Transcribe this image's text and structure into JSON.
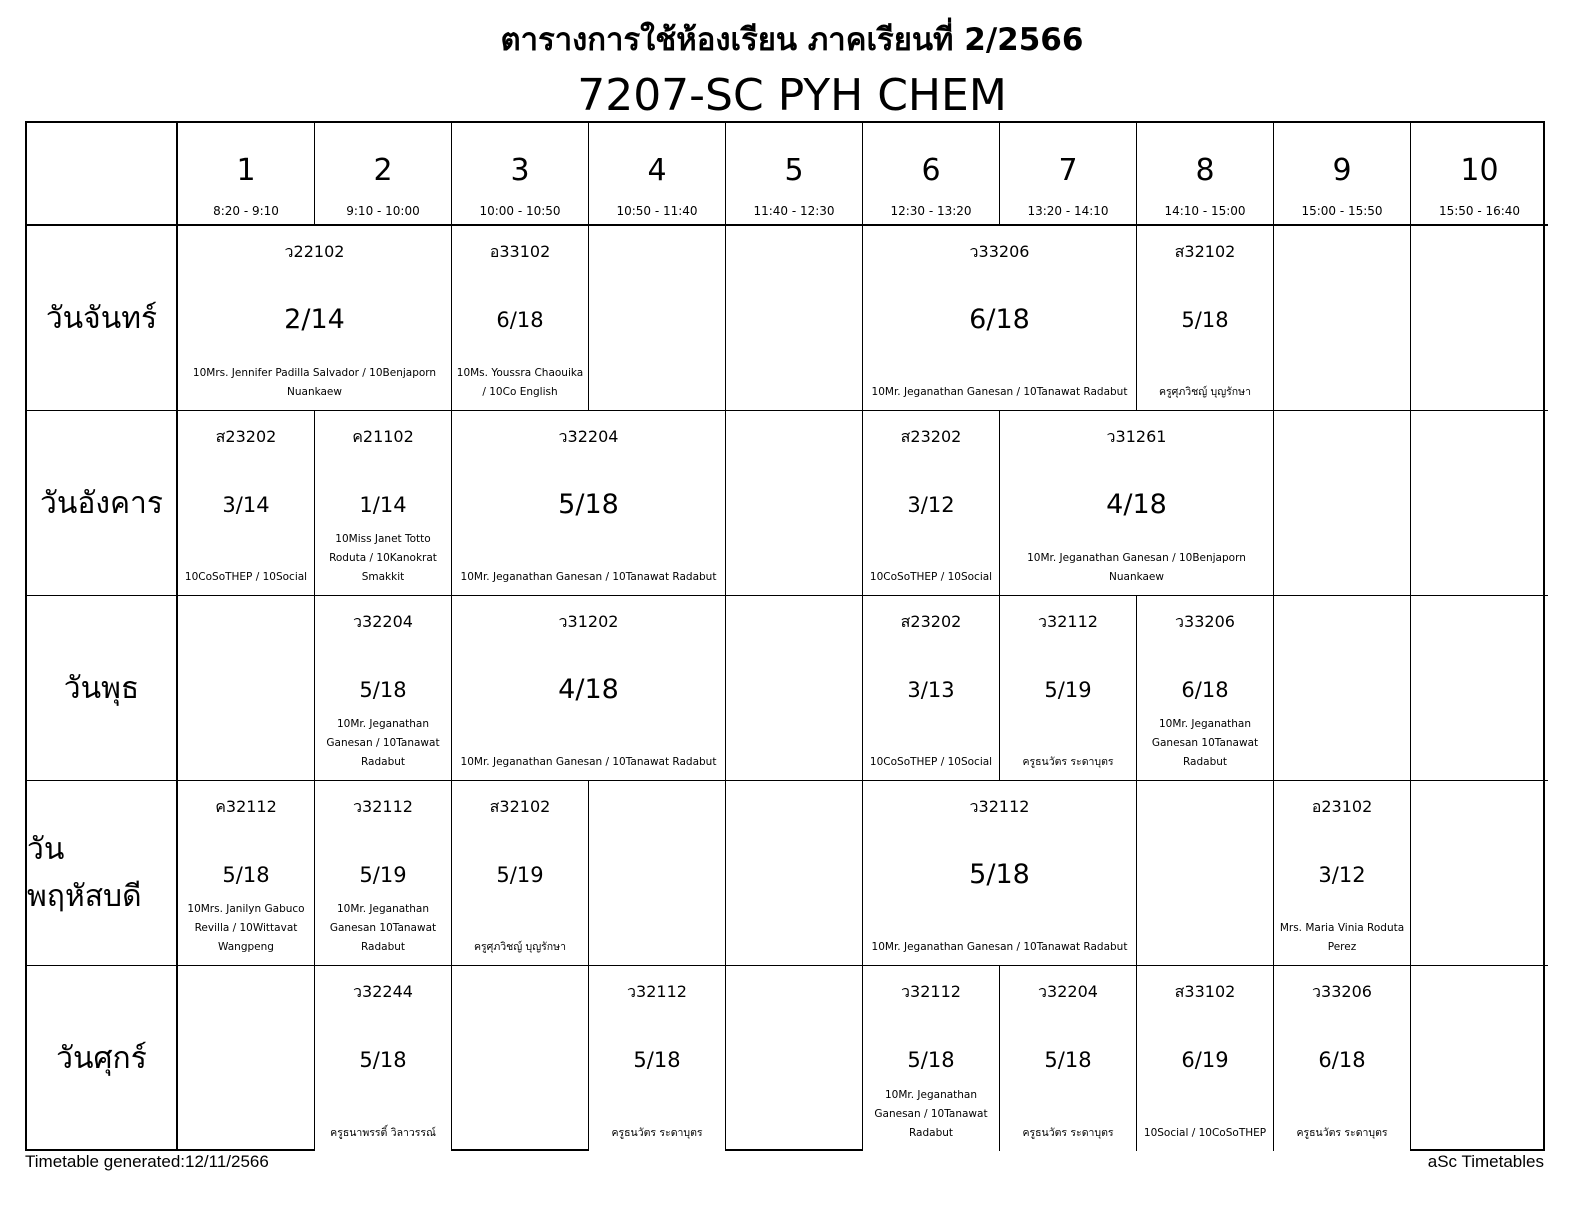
{
  "header": {
    "title": "ตารางการใช้ห้องเรียน ภาคเรียนที่ 2/2566",
    "room": "7207-SC PYH CHEM"
  },
  "periods": [
    {
      "num": "1",
      "time": "8:20 - 9:10"
    },
    {
      "num": "2",
      "time": "9:10 - 10:00"
    },
    {
      "num": "3",
      "time": "10:00 - 10:50"
    },
    {
      "num": "4",
      "time": "10:50 - 11:40"
    },
    {
      "num": "5",
      "time": "11:40 - 12:30"
    },
    {
      "num": "6",
      "time": "12:30 - 13:20"
    },
    {
      "num": "7",
      "time": "13:20 - 14:10"
    },
    {
      "num": "8",
      "time": "14:10 - 15:00"
    },
    {
      "num": "9",
      "time": "15:00 - 15:50"
    },
    {
      "num": "10",
      "time": "15:50 - 16:40"
    }
  ],
  "days": [
    {
      "name": "วันจันทร์",
      "lessons": [
        {
          "start": 1,
          "span": 2,
          "subject": "ว22102",
          "class": "2/14",
          "teacher": "10Mrs. Jennifer Padilla Salvador / 10Benjaporn Nuankaew"
        },
        {
          "start": 3,
          "span": 1,
          "subject": "อ33102",
          "class": "6/18",
          "teacher": "10Ms. Youssra Chaouika / 10Co English"
        },
        {
          "start": 6,
          "span": 2,
          "subject": "ว33206",
          "class": "6/18",
          "teacher": "10Mr. Jeganathan Ganesan / 10Tanawat Radabut"
        },
        {
          "start": 8,
          "span": 1,
          "subject": "ส32102",
          "class": "5/18",
          "teacher": "ครูศุภวิชญ์ บุญรักษา"
        }
      ]
    },
    {
      "name": "วันอังคาร",
      "lessons": [
        {
          "start": 1,
          "span": 1,
          "subject": "ส23202",
          "class": "3/14",
          "teacher": "10CoSoTHEP / 10Social"
        },
        {
          "start": 2,
          "span": 1,
          "subject": "ค21102",
          "class": "1/14",
          "teacher": "10Miss Janet Totto Roduta / 10Kanokrat Smakkit"
        },
        {
          "start": 3,
          "span": 2,
          "subject": "ว32204",
          "class": "5/18",
          "teacher": "10Mr. Jeganathan Ganesan / 10Tanawat Radabut"
        },
        {
          "start": 6,
          "span": 1,
          "subject": "ส23202",
          "class": "3/12",
          "teacher": "10CoSoTHEP / 10Social"
        },
        {
          "start": 7,
          "span": 2,
          "subject": "ว31261",
          "class": "4/18",
          "teacher": "10Mr. Jeganathan Ganesan / 10Benjaporn Nuankaew"
        }
      ]
    },
    {
      "name": "วันพุธ",
      "lessons": [
        {
          "start": 2,
          "span": 1,
          "subject": "ว32204",
          "class": "5/18",
          "teacher": "10Mr. Jeganathan Ganesan / 10Tanawat Radabut"
        },
        {
          "start": 3,
          "span": 2,
          "subject": "ว31202",
          "class": "4/18",
          "teacher": "10Mr. Jeganathan Ganesan / 10Tanawat Radabut"
        },
        {
          "start": 6,
          "span": 1,
          "subject": "ส23202",
          "class": "3/13",
          "teacher": "10CoSoTHEP / 10Social"
        },
        {
          "start": 7,
          "span": 1,
          "subject": "ว32112",
          "class": "5/19",
          "teacher": "ครูธนวัตร ระดาบุตร"
        },
        {
          "start": 8,
          "span": 1,
          "subject": "ว33206",
          "class": "6/18",
          "teacher": "10Mr. Jeganathan Ganesan 10Tanawat Radabut"
        }
      ]
    },
    {
      "name": "วันพฤหัสบดี",
      "lessons": [
        {
          "start": 1,
          "span": 1,
          "subject": "ค32112",
          "class": "5/18",
          "teacher": "10Mrs. Janilyn Gabuco Revilla / 10Wittavat Wangpeng"
        },
        {
          "start": 2,
          "span": 1,
          "subject": "ว32112",
          "class": "5/19",
          "teacher": "10Mr. Jeganathan Ganesan 10Tanawat Radabut"
        },
        {
          "start": 3,
          "span": 1,
          "subject": "ส32102",
          "class": "5/19",
          "teacher": "ครูศุภวิชญ์ บุญรักษา"
        },
        {
          "start": 6,
          "span": 2,
          "subject": "ว32112",
          "class": "5/18",
          "teacher": "10Mr. Jeganathan Ganesan / 10Tanawat Radabut"
        },
        {
          "start": 9,
          "span": 1,
          "subject": "อ23102",
          "class": "3/12",
          "teacher": "Mrs. Maria Vinia Roduta Perez"
        }
      ]
    },
    {
      "name": "วันศุกร์",
      "lessons": [
        {
          "start": 2,
          "span": 1,
          "subject": "ว32244",
          "class": "5/18",
          "teacher": "ครูธนาพรรติ์ วิลาวรรณ์"
        },
        {
          "start": 4,
          "span": 1,
          "subject": "ว32112",
          "class": "5/18",
          "teacher": "ครูธนวัตร ระดาบุตร"
        },
        {
          "start": 6,
          "span": 1,
          "subject": "ว32112",
          "class": "5/18",
          "teacher": "10Mr. Jeganathan Ganesan / 10Tanawat Radabut"
        },
        {
          "start": 7,
          "span": 1,
          "subject": "ว32204",
          "class": "5/18",
          "teacher": "ครูธนวัตร ระดาบุตร"
        },
        {
          "start": 8,
          "span": 1,
          "subject": "ส33102",
          "class": "6/19",
          "teacher": "10Social / 10CoSoTHEP"
        },
        {
          "start": 9,
          "span": 1,
          "subject": "ว33206",
          "class": "6/18",
          "teacher": "ครูธนวัตร ระดาบุตร"
        }
      ]
    }
  ],
  "footer": {
    "generated": "Timetable generated:12/11/2566",
    "brand": "aSc Timetables"
  }
}
